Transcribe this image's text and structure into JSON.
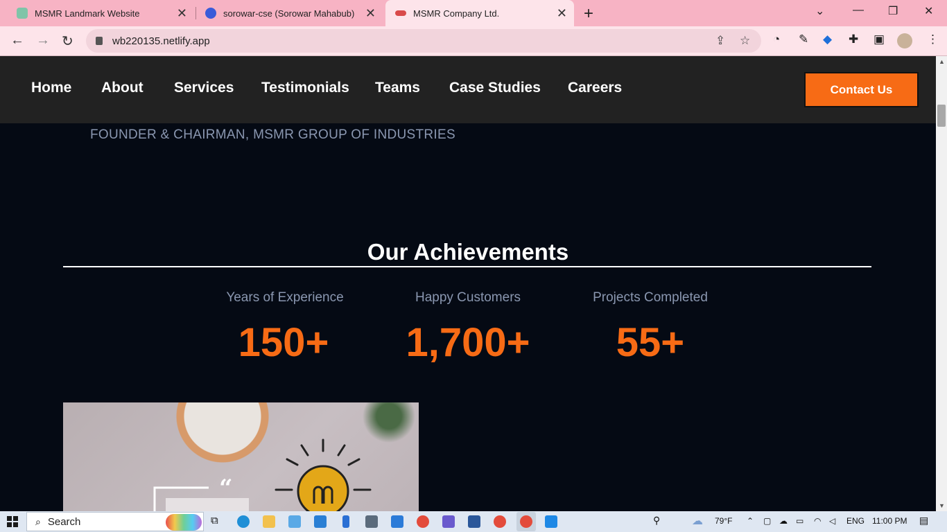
{
  "browser": {
    "tabs": [
      {
        "title": "MSMR Landmark Website",
        "active": false
      },
      {
        "title": "sorowar-cse (Sorowar Mahabub)",
        "active": false
      },
      {
        "title": "MSMR Company Ltd.",
        "active": true
      }
    ],
    "url": "wb220135.netlify.app"
  },
  "site": {
    "nav": [
      "Home",
      "About",
      "Services",
      "Testimonials",
      "Teams",
      "Case Studies",
      "Careers"
    ],
    "contact_label": "Contact Us",
    "founder_caption": "FOUNDER & CHAIRMAN, MSMR GROUP OF INDUSTRIES",
    "achievements": {
      "title": "Our Achievements",
      "stats": [
        {
          "label": "Years of Experience",
          "value": "150+"
        },
        {
          "label": "Happy Customers",
          "value": "1,700+"
        },
        {
          "label": "Projects Completed",
          "value": "55+"
        }
      ]
    },
    "quote_mark": "“",
    "accent_color": "#f76b15"
  },
  "taskbar": {
    "search_label": "Search",
    "weather": "79°F",
    "language": "ENG",
    "time": "11:00 PM"
  }
}
